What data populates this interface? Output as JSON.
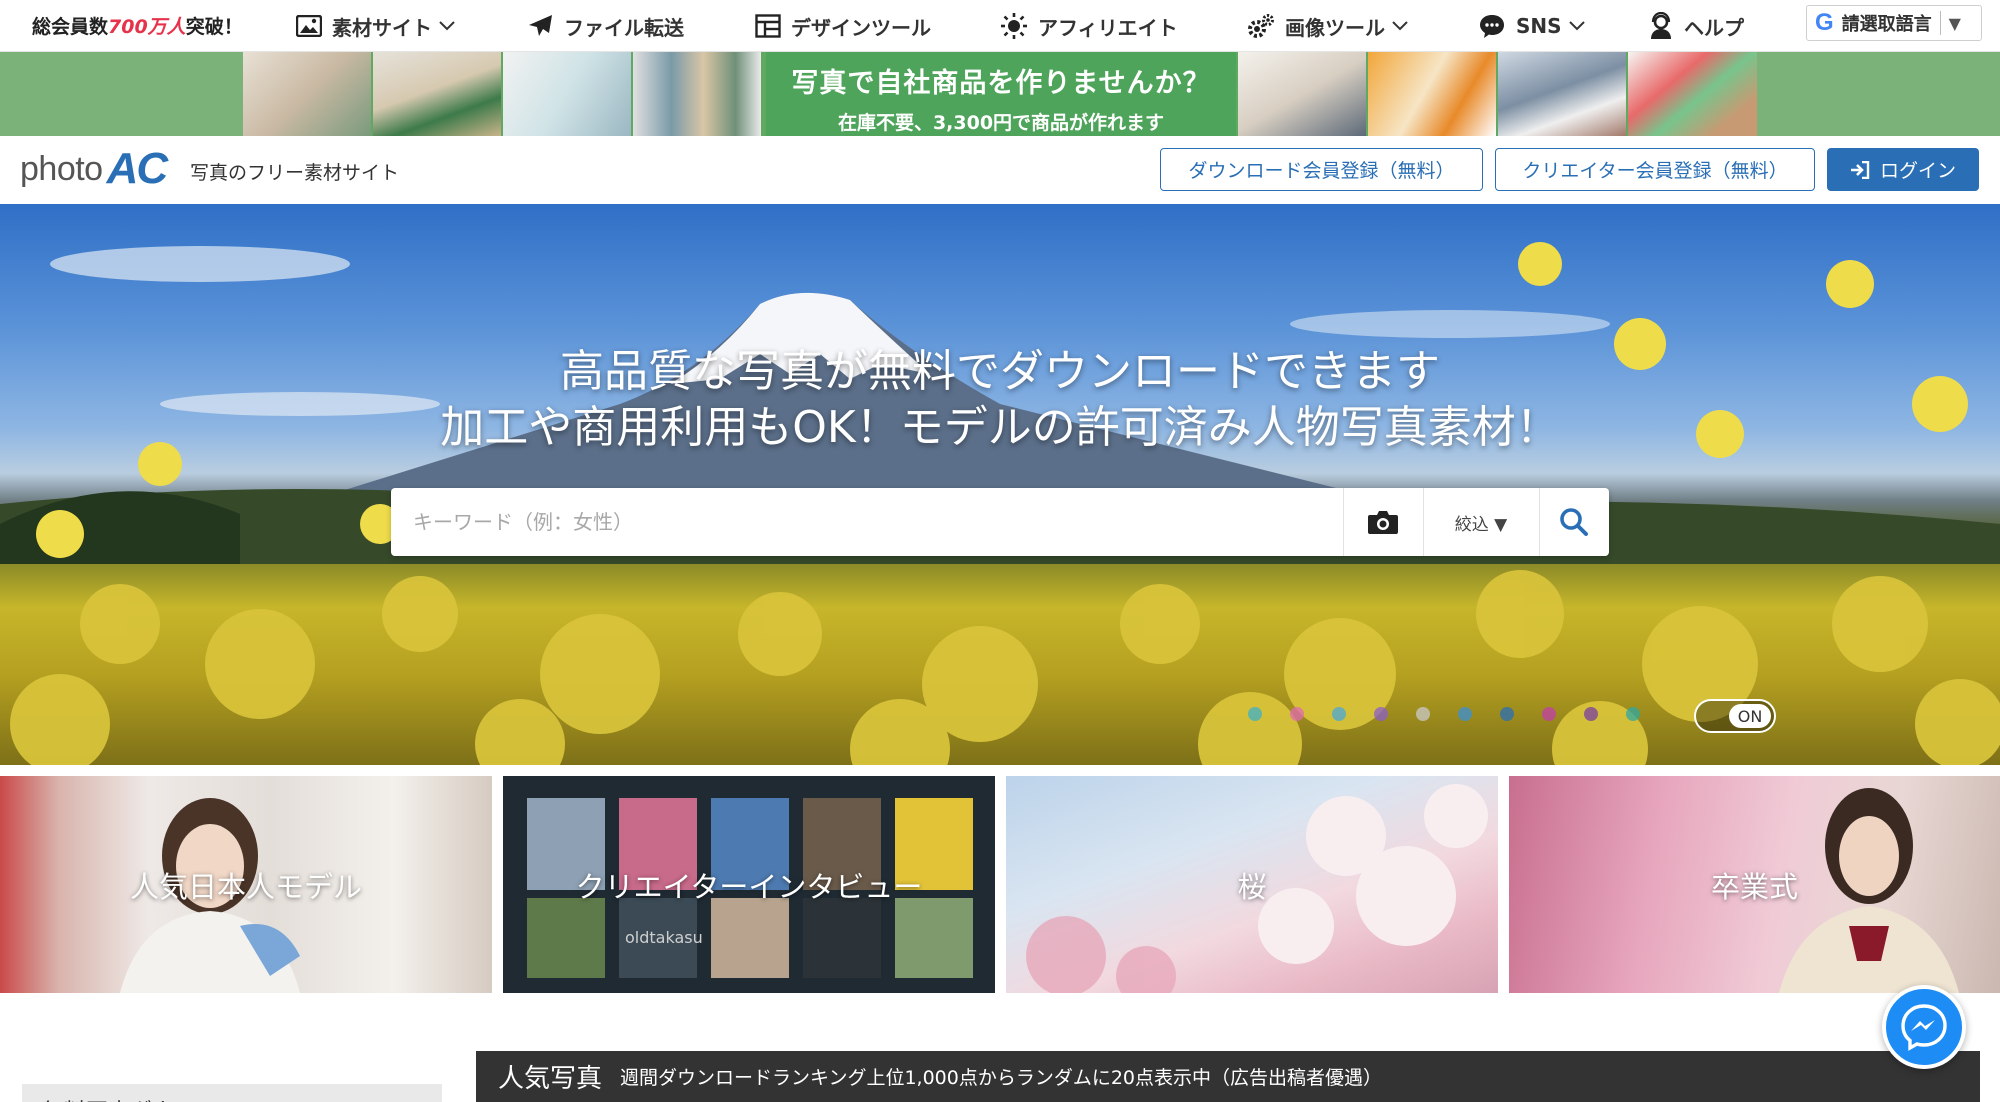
{
  "topnav": {
    "members_prefix": "総会員数",
    "members_highlight": "700万人",
    "members_suffix": "突破！",
    "items": [
      {
        "label": "素材サイト",
        "icon": "image-icon"
      },
      {
        "label": "ファイル転送",
        "icon": "paper-plane-icon"
      },
      {
        "label": "デザインツール",
        "icon": "layout-icon"
      },
      {
        "label": "アフィリエイト",
        "icon": "sun-icon"
      },
      {
        "label": "画像ツール",
        "icon": "gears-icon"
      },
      {
        "label": "SNS",
        "icon": "chat-icon"
      },
      {
        "label": "ヘルプ",
        "icon": "support-icon"
      }
    ],
    "language": {
      "g": "G",
      "label": "請選取語言",
      "arrow": "▼"
    }
  },
  "ad": {
    "headline": "写真で自社商品を作りませんか？",
    "sub": "在庫不要、3,300円で商品が作れます"
  },
  "header": {
    "logo_photo": "photo",
    "logo_ac": "AC",
    "tagline": "写真のフリー素材サイト",
    "download_register": "ダウンロード会員登録（無料）",
    "creator_register": "クリエイター会員登録（無料）",
    "login": "ログイン"
  },
  "hero": {
    "line1": "高品質な写真が無料でダウンロードできます",
    "line2": "加工や商用利用もOK！モデルの許可済み人物写真素材！",
    "search_placeholder": "キーワード（例：女性）",
    "filter_label": "絞込 ▼",
    "toggle": "ON",
    "dot_colors": [
      "#3fb0c8",
      "#e06bb0",
      "#4aa8d8",
      "#8b5fc8",
      "#c9c9c9",
      "#3b8fd6",
      "#2a6fb5",
      "#c23fa8",
      "#7a3fa0",
      "#2fa8a0"
    ]
  },
  "categories": [
    {
      "label": "人気日本人モデル"
    },
    {
      "label": "クリエイターインタビュー",
      "thumb_text": "oldtakasu"
    },
    {
      "label": "桜"
    },
    {
      "label": "卒業式"
    }
  ],
  "sidebar": {
    "title": "無料写真ダウンロード"
  },
  "popular": {
    "title": "人気写真",
    "desc": "週間ダウンロードランキング上位1,000点からランダムに20点表示中（広告出稿者優遇）"
  }
}
